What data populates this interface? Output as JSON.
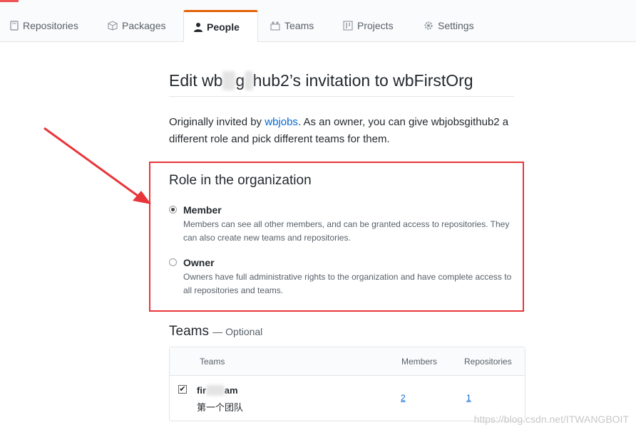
{
  "nav": {
    "tabs": [
      {
        "label": "Repositories",
        "icon": "repo-icon"
      },
      {
        "label": "Packages",
        "icon": "package-icon"
      },
      {
        "label": "People",
        "icon": "person-icon",
        "selected": true
      },
      {
        "label": "Teams",
        "icon": "teams-icon"
      },
      {
        "label": "Projects",
        "icon": "project-icon"
      },
      {
        "label": "Settings",
        "icon": "gear-icon"
      }
    ]
  },
  "page": {
    "title_prefix": "Edit ",
    "title_user_visible_start": "wb",
    "title_user_blur1": "jo",
    "title_user_mid": "g",
    "title_user_blur2": "it",
    "title_user_visible_end": "hub2",
    "title_suffix": "’s invitation to wbFirstOrg",
    "intro_before_link": "Originally invited by ",
    "intro_link": "wbjobs",
    "intro_after_link": ". As an owner, you can give wbjobsgithub2 a different role and pick different teams for them."
  },
  "role": {
    "heading": "Role in the organization",
    "options": [
      {
        "label": "Member",
        "description": "Members can see all other members, and can be granted access to repositories. They can also create new teams and repositories.",
        "checked": true
      },
      {
        "label": "Owner",
        "description": "Owners have full administrative rights to the organization and have complete access to all repositories and teams.",
        "checked": false
      }
    ]
  },
  "teams": {
    "heading": "Teams",
    "optional": "— Optional",
    "columns": [
      "Teams",
      "Members",
      "Repositories"
    ],
    "rows": [
      {
        "name_visible": "fir",
        "name_blurred": "stTe",
        "name_end": "am",
        "description": "第一个团队",
        "members": "2",
        "repositories": "1",
        "checked": true
      }
    ]
  },
  "watermark": "https://blog.csdn.net/ITWANGBOIT",
  "colors": {
    "accent_tab": "#e36209",
    "highlight_box": "#e8353a",
    "link": "#0366d6"
  }
}
